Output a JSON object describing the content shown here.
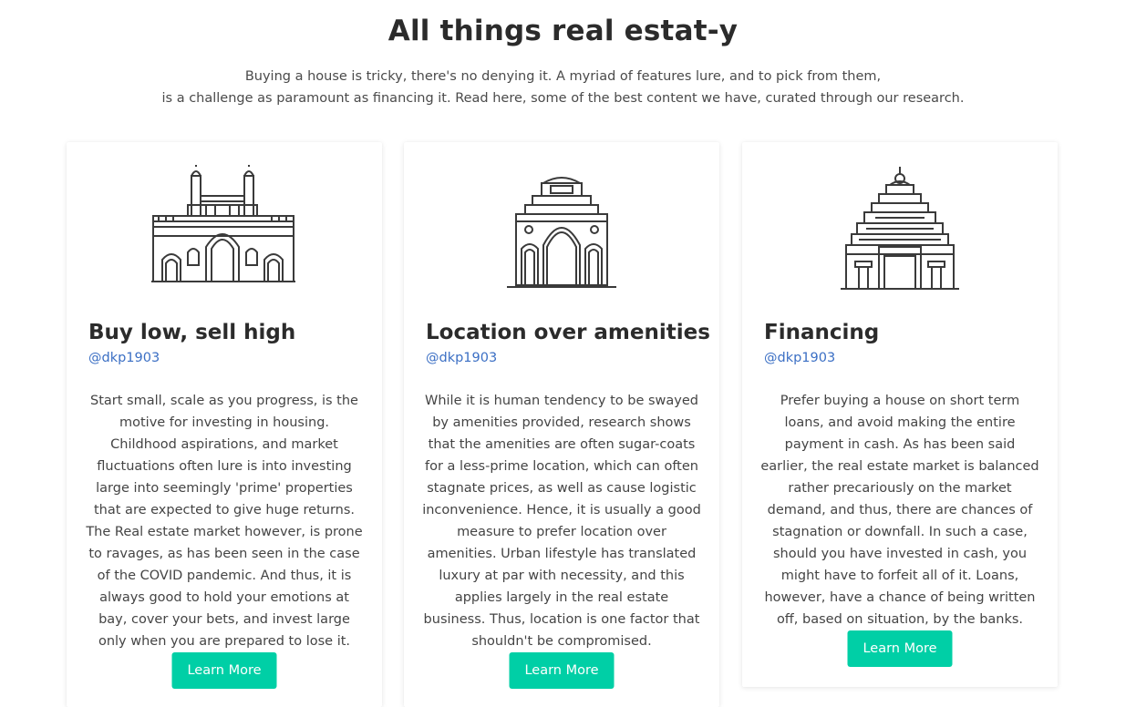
{
  "header": {
    "title": "All things real estat-y",
    "intro_line1": "Buying a house is tricky, there's no denying it. A myriad of features lure, and to pick from them,",
    "intro_line2": "is a challenge as paramount as financing it. Read here, some of the best content we have, curated through our research."
  },
  "cards": [
    {
      "icon": "gateway-of-india-icon",
      "title": "Buy low, sell high",
      "handle": "@dkp1903",
      "body": "Start small, scale as you progress, is the motive for investing in housing. Childhood aspirations, and market fluctuations often lure is into investing large into seemingly 'prime' properties that are expected to give huge returns. The Real estate market however, is prone to ravages, as has been seen in the case of the COVID pandemic. And thus, it is always good to hold your emotions at bay, cover your bets, and invest large only when you are prepared to lose it.",
      "button": "Learn More"
    },
    {
      "icon": "india-gate-icon",
      "title": "Location over amenities",
      "handle": "@dkp1903",
      "body": "While it is human tendency to be swayed by amenities provided, research shows that the amenities are often sugar-coats for a less-prime location, which can often stagnate prices, as well as cause logistic inconvenience. Hence, it is usually a good measure to prefer location over amenities. Urban lifestyle has translated luxury at par with necessity, and this applies largely in the real estate business. Thus, location is one factor that shouldn't be compromised.",
      "button": "Learn More"
    },
    {
      "icon": "temple-icon",
      "title": "Financing",
      "handle": "@dkp1903",
      "body": "Prefer buying a house on short term loans, and avoid making the entire payment in cash. As has been said earlier, the real estate market is balanced rather precariously on the market demand, and thus, there are chances of stagnation or downfall. In such a case, should you have invested in cash, you might have to forfeit all of it. Loans, however, have a chance of being written off, based on situation, by the banks.",
      "button": "Learn More"
    }
  ],
  "colors": {
    "accent": "#00cfa6",
    "link": "#3b6fc4",
    "title": "#2b2b2b"
  }
}
